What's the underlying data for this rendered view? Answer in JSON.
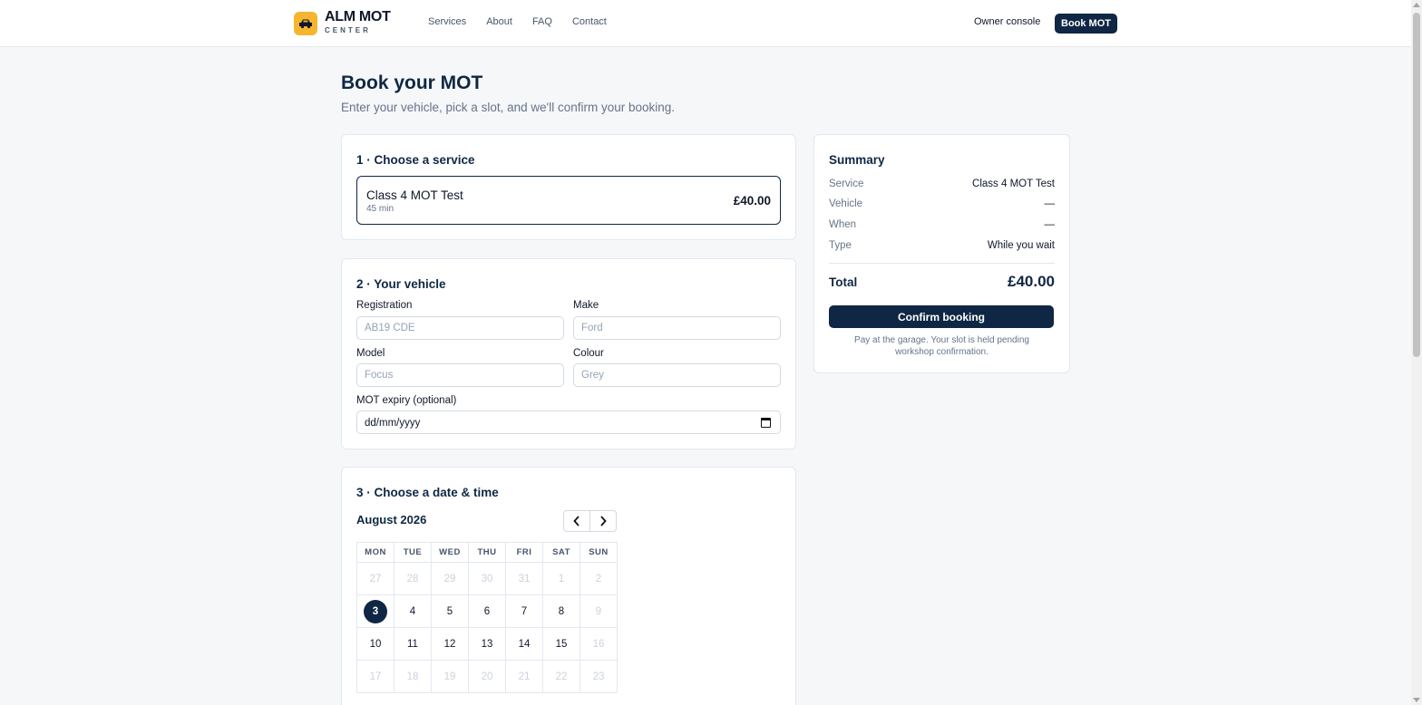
{
  "header": {
    "brand_name": "ALM MOT",
    "brand_sub": "CENTER",
    "logo_icon": "car-icon",
    "nav": [
      "Services",
      "About",
      "FAQ",
      "Contact"
    ],
    "owner_console": "Owner console",
    "book_button": "Book MOT",
    "colors": {
      "logo_bg": "#f5b52e",
      "primary": "#0f2744"
    }
  },
  "page": {
    "title": "Book your MOT",
    "subtitle": "Enter your vehicle, pick a slot, and we'll confirm your booking."
  },
  "service_section": {
    "title": "1 · Choose a service",
    "option": {
      "name": "Class 4 MOT Test",
      "duration": "45 min",
      "price": "£40.00"
    }
  },
  "vehicle_section": {
    "title": "2 · Your vehicle",
    "registration": {
      "label": "Registration",
      "placeholder": "AB19 CDE",
      "value": ""
    },
    "make": {
      "label": "Make",
      "placeholder": "Ford",
      "value": ""
    },
    "model": {
      "label": "Model",
      "placeholder": "Focus",
      "value": ""
    },
    "colour": {
      "label": "Colour",
      "placeholder": "Grey",
      "value": ""
    },
    "mot_expiry": {
      "label": "MOT expiry (optional)",
      "value": "dd/mm/yyyy"
    }
  },
  "date_section": {
    "title": "3 · Choose a date & time",
    "month": "August 2026",
    "weekdays": [
      "MON",
      "TUE",
      "WED",
      "THU",
      "FRI",
      "SAT",
      "SUN"
    ],
    "weeks": [
      [
        {
          "d": "27",
          "m": true
        },
        {
          "d": "28",
          "m": true
        },
        {
          "d": "29",
          "m": true
        },
        {
          "d": "30",
          "m": true
        },
        {
          "d": "31",
          "m": true
        },
        {
          "d": "1",
          "m": true
        },
        {
          "d": "2",
          "m": true
        }
      ],
      [
        {
          "d": "3",
          "s": true
        },
        {
          "d": "4"
        },
        {
          "d": "5"
        },
        {
          "d": "6"
        },
        {
          "d": "7"
        },
        {
          "d": "8"
        },
        {
          "d": "9",
          "m": true
        }
      ],
      [
        {
          "d": "10"
        },
        {
          "d": "11"
        },
        {
          "d": "12"
        },
        {
          "d": "13"
        },
        {
          "d": "14"
        },
        {
          "d": "15"
        },
        {
          "d": "16",
          "m": true
        }
      ],
      [
        {
          "d": "17",
          "m": true
        },
        {
          "d": "18",
          "m": true
        },
        {
          "d": "19",
          "m": true
        },
        {
          "d": "20",
          "m": true
        },
        {
          "d": "21",
          "m": true
        },
        {
          "d": "22",
          "m": true
        },
        {
          "d": "23",
          "m": true
        }
      ]
    ]
  },
  "summary": {
    "title": "Summary",
    "rows": [
      {
        "k": "Service",
        "v": "Class 4 MOT Test"
      },
      {
        "k": "Vehicle",
        "v": "—"
      },
      {
        "k": "When",
        "v": "—"
      },
      {
        "k": "Type",
        "v": "While you wait"
      }
    ],
    "total_label": "Total",
    "total_value": "£40.00",
    "confirm_button": "Confirm booking",
    "note": "Pay at the garage. Your slot is held pending workshop confirmation."
  }
}
